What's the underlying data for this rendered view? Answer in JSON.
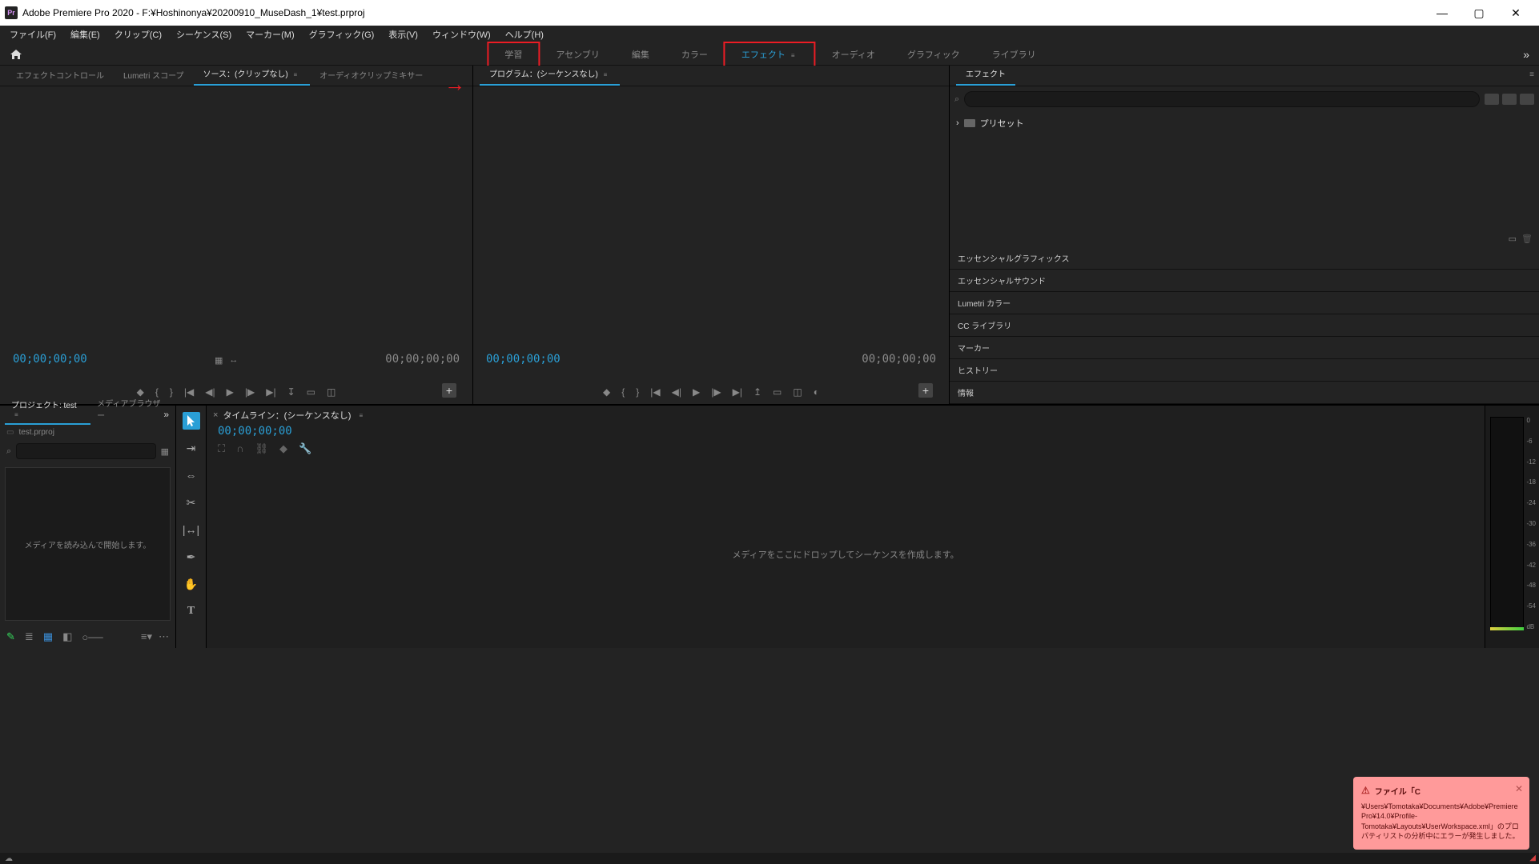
{
  "title_bar": {
    "app_name": "Adobe Premiere Pro 2020",
    "doc_path": "F:¥Hoshinonya¥20200910_MuseDash_1¥test.prproj",
    "full_title": "Adobe Premiere Pro 2020 - F:¥Hoshinonya¥20200910_MuseDash_1¥test.prproj",
    "icon_label": "Pr"
  },
  "menu_bar": {
    "items": [
      "ファイル(F)",
      "編集(E)",
      "クリップ(C)",
      "シーケンス(S)",
      "マーカー(M)",
      "グラフィック(G)",
      "表示(V)",
      "ウィンドウ(W)",
      "ヘルプ(H)"
    ]
  },
  "workspace_tabs": {
    "items": [
      "学習",
      "アセンブリ",
      "編集",
      "カラー",
      "エフェクト",
      "オーディオ",
      "グラフィック",
      "ライブラリ"
    ],
    "active_index": 4,
    "boxed_indices": [
      0,
      4
    ]
  },
  "source_panel": {
    "tabs": [
      "エフェクトコントロール",
      "Lumetri スコープ",
      "ソース：(クリップなし)",
      "オーディオクリップミキサー"
    ],
    "active_index": 2,
    "time_left": "00;00;00;00",
    "time_right": "00;00;00;00"
  },
  "program_panel": {
    "title": "プログラム：(シーケンスなし)",
    "time_left": "00;00;00;00",
    "time_right": "00;00;00;00"
  },
  "effects_panel": {
    "title": "エフェクト",
    "presets_label": "プリセット",
    "side_panels": [
      "エッセンシャルグラフィックス",
      "エッセンシャルサウンド",
      "Lumetri カラー",
      "CC ライブラリ",
      "マーカー",
      "ヒストリー",
      "情報"
    ]
  },
  "project_panel": {
    "tabs": [
      "プロジェクト: test",
      "メディアブラウザー"
    ],
    "active_index": 0,
    "breadcrumb": "test.prproj",
    "empty_text": "メディアを読み込んで開始します。"
  },
  "timeline_panel": {
    "title": "タイムライン：(シーケンスなし)",
    "timecode": "00;00;00;00",
    "empty_text": "メディアをここにドロップしてシーケンスを作成します。"
  },
  "audio_meter": {
    "scale": [
      "0",
      "-6",
      "-12",
      "-18",
      "-24",
      "-30",
      "-36",
      "-42",
      "-48",
      "-54",
      "dB"
    ]
  },
  "error_toast": {
    "header": "ファイル「C",
    "body": "¥Users¥Tomotaka¥Documents¥Adobe¥Premiere Pro¥14.0¥Profile-Tomotaka¥Layouts¥UserWorkspace.xml」のプロパティリストの分析中にエラーが発生しました。"
  }
}
